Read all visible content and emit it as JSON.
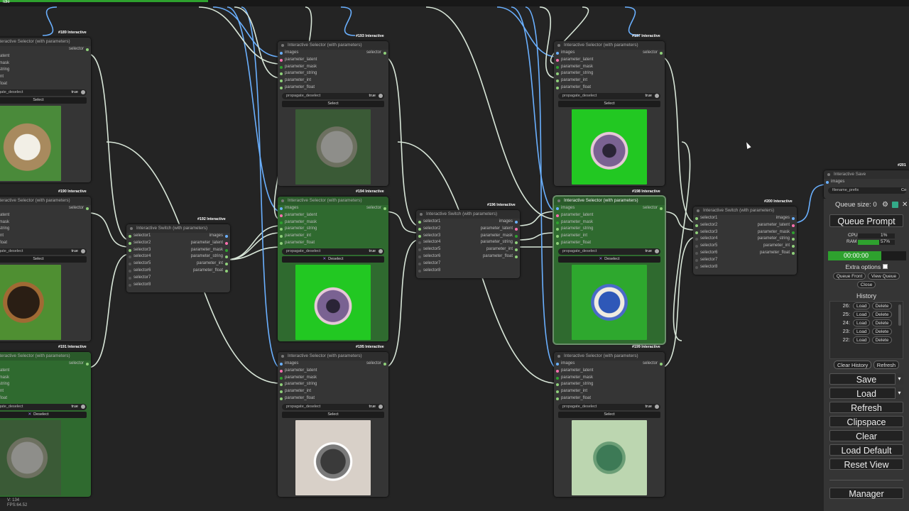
{
  "status": {
    "label": "Idle",
    "progress": 0.23
  },
  "node_template": {
    "inputs": [
      "images",
      "parameter_latent",
      "parameter_mask",
      "parameter_string",
      "parameter_int",
      "parameter_float"
    ],
    "output": "selector",
    "widget_label": "propagate_deselect",
    "widget_value": "true",
    "select_label": "Select",
    "deselect_label": "Deselect"
  },
  "switch_template": {
    "inputs": [
      "selector1",
      "selector2",
      "selector3",
      "selector4",
      "selector5",
      "selector6",
      "selector7",
      "selector8"
    ],
    "outputs": [
      "images",
      "parameter_latent",
      "parameter_mask",
      "parameter_string",
      "parameter_int",
      "parameter_float"
    ]
  },
  "left_stub_inputs": [
    "er_latent",
    "er_mask",
    "er_string",
    "er_int",
    "er_float"
  ],
  "left_stub_widget": "pagate_deselect",
  "nodes": [
    {
      "id": "n189",
      "tag": "#189 Interactive",
      "title": "Interactive Selector (with parameters)",
      "selected": false,
      "button": "Select",
      "image": "kitten photo"
    },
    {
      "id": "n190",
      "tag": "#190 Interactive",
      "title": "Interactive Selector (with parameters)",
      "selected": false,
      "button": "Select",
      "image": "puppy photo"
    },
    {
      "id": "n191",
      "tag": "#191 Interactive",
      "title": "Interactive Selector (with parameters)",
      "selected": true,
      "button": "Deselect",
      "image": "grey rat photo"
    },
    {
      "id": "n193",
      "tag": "#193 Interactive",
      "title": "Interactive Selector (with parameters)",
      "selected": false,
      "button": "Select",
      "image": "grey rat photo"
    },
    {
      "id": "n194",
      "tag": "#194 Interactive",
      "title": "Interactive Selector (with parameters)",
      "selected": true,
      "button": "Deselect",
      "image": "cartoon mouse"
    },
    {
      "id": "n195",
      "tag": "#195 Interactive",
      "title": "Interactive Selector (with parameters)",
      "selected": false,
      "button": "Select",
      "image": "rat portrait"
    },
    {
      "id": "n197",
      "tag": "#197 Interactive",
      "title": "Interactive Selector (with parameters)",
      "selected": false,
      "button": "Select",
      "image": "cartoon mouse"
    },
    {
      "id": "n198",
      "tag": "#198 Interactive",
      "title": "Interactive Selector (with parameters)",
      "selected": true,
      "button": "Deselect",
      "image": "blue knitted mouse"
    },
    {
      "id": "n199",
      "tag": "#199 Interactive",
      "title": "Interactive Selector (with parameters)",
      "selected": false,
      "button": "Select",
      "image": "green knitted rat"
    }
  ],
  "switches": [
    {
      "id": "s192",
      "tag": "#192 Interactive",
      "title": "Interactive Switch (with parameters)"
    },
    {
      "id": "s196",
      "tag": "#196 Interactive",
      "title": "Interactive Switch (with parameters)"
    },
    {
      "id": "s200",
      "tag": "#200 Interactive",
      "title": "Interactive Switch (with parameters)"
    }
  ],
  "save_node": {
    "tag": "#201",
    "title": "Interactive Save",
    "input": "images",
    "widget": "filename_prefix",
    "widget_value": "Co"
  },
  "panel": {
    "queue_size": "Queue size: 0",
    "queue_prompt": "Queue Prompt",
    "cpu_label": "CPU",
    "cpu_value": "1%",
    "ram_label": "RAM",
    "ram_value": "57%",
    "timer": "00:00:00",
    "extra_options": "Extra options",
    "queue_front": "Queue Front",
    "view_queue": "View Queue",
    "close": "Close",
    "history_title": "History",
    "history": [
      "26:",
      "25:",
      "24:",
      "23:",
      "22:"
    ],
    "load": "Load",
    "delete": "Delete",
    "clear_history": "Clear History",
    "refresh_small": "Refresh",
    "buttons": [
      "Save",
      "Load",
      "Refresh",
      "Clipspace",
      "Clear",
      "Load Default",
      "Reset View"
    ],
    "manager": "Manager"
  },
  "footer": {
    "version": "V: 134",
    "fps": "FPS:64.52"
  },
  "colors": {
    "accent_green": "#2ea12e",
    "selected_node": "#2f6a2f",
    "wire_blue": "#6ab0ff",
    "wire_white": "#d8e6d8"
  }
}
